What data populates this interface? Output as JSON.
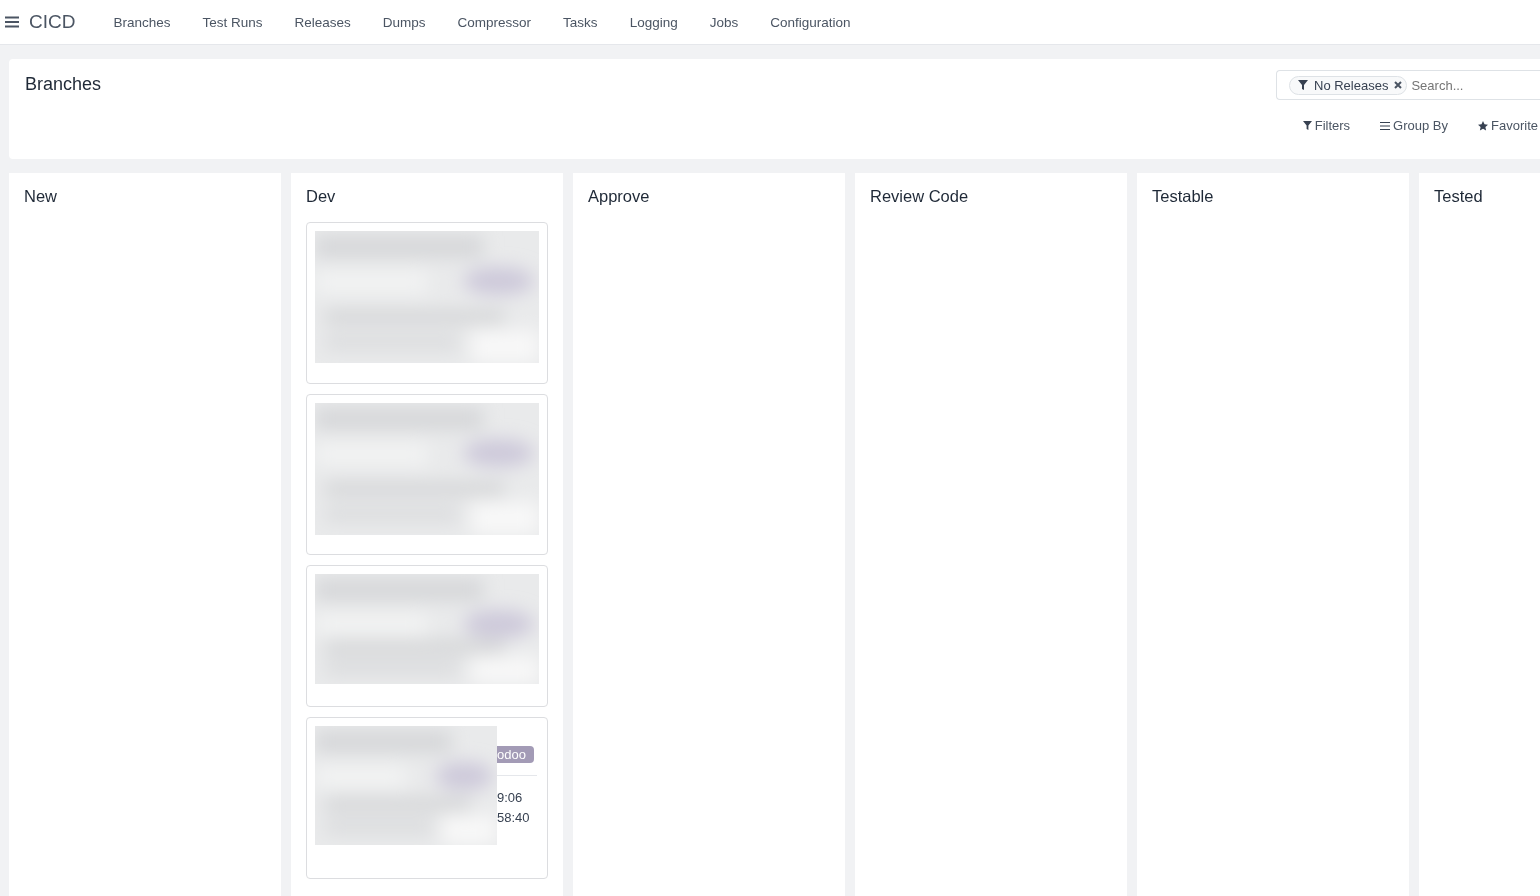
{
  "app_title": "CICD",
  "menu": [
    "Branches",
    "Test Runs",
    "Releases",
    "Dumps",
    "Compressor",
    "Tasks",
    "Logging",
    "Jobs",
    "Configuration"
  ],
  "page_title": "Branches",
  "search": {
    "facets": [
      {
        "label": "No Releases"
      }
    ],
    "placeholder": "Search..."
  },
  "toolbar": [
    {
      "kind": "filter",
      "label": "Filters"
    },
    {
      "kind": "group",
      "label": "Group By"
    },
    {
      "kind": "star",
      "label": "Favorite"
    }
  ],
  "columns": [
    {
      "title": "New"
    },
    {
      "title": "Dev",
      "cards": [
        {
          "kind": "blurred"
        },
        {
          "kind": "blurred"
        },
        {
          "kind": "blurred"
        },
        {
          "kind": "partial",
          "tag": "odoo",
          "lines": [
            "9:06",
            "58:40"
          ]
        }
      ]
    },
    {
      "title": "Approve"
    },
    {
      "title": "Review Code"
    },
    {
      "title": "Testable"
    },
    {
      "title": "Tested"
    }
  ]
}
